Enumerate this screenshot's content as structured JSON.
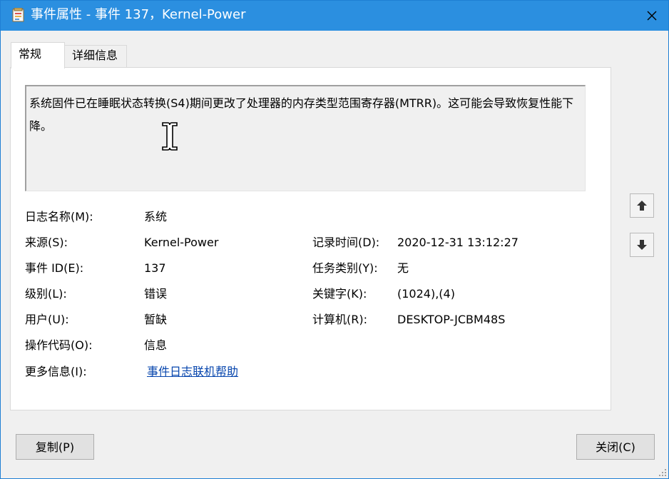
{
  "window": {
    "title": "事件属性 - 事件 137，Kernel-Power",
    "icon": "event-viewer-icon",
    "close_icon": "close-icon"
  },
  "tabs": [
    {
      "label": "常规",
      "selected": true
    },
    {
      "label": "详细信息",
      "selected": false
    }
  ],
  "description": "系统固件已在睡眠状态转换(S4)期间更改了处理器的内存类型范围寄存器(MTRR)。这可能会导致恢复性能下降。",
  "fields": {
    "log_name_label": "日志名称(M):",
    "log_name_value": "系统",
    "source_label": "来源(S):",
    "source_value": "Kernel-Power",
    "logged_label": "记录时间(D):",
    "logged_value": "2020-12-31 13:12:27",
    "event_id_label": "事件 ID(E):",
    "event_id_value": "137",
    "task_category_label": "任务类别(Y):",
    "task_category_value": "无",
    "level_label": "级别(L):",
    "level_value": "错误",
    "keywords_label": "关键字(K):",
    "keywords_value": "(1024),(4)",
    "user_label": "用户(U):",
    "user_value": "暂缺",
    "computer_label": "计算机(R):",
    "computer_value": "DESKTOP-JCBM48S",
    "opcode_label": "操作代码(O):",
    "opcode_value": "信息",
    "more_info_label": "更多信息(I):",
    "more_info_link": "事件日志联机帮助"
  },
  "nav": {
    "up_icon": "arrow-up-icon",
    "down_icon": "arrow-down-icon"
  },
  "buttons": {
    "copy_label": "复制(P)",
    "close_label": "关闭(C)"
  },
  "colors": {
    "titlebar": "#2b8fe0",
    "link": "#0645ad"
  }
}
